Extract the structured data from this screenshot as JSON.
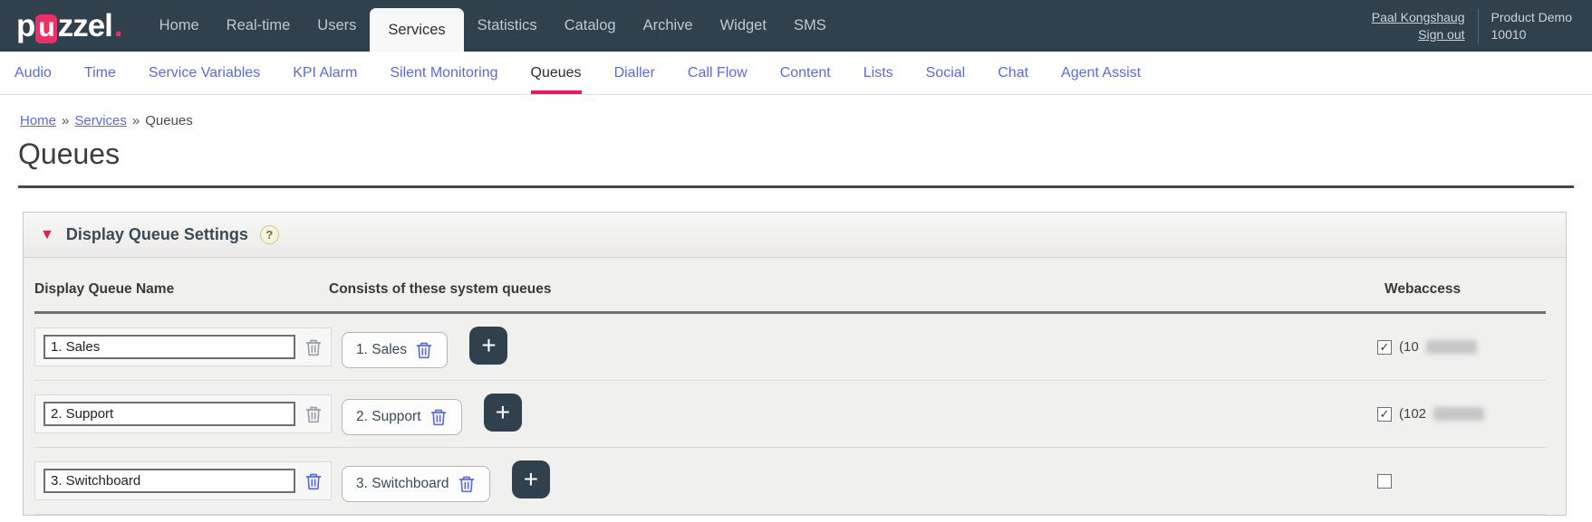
{
  "colors": {
    "brand_pink": "#e8195c",
    "navy": "#31404d",
    "link_blue": "#5b6bd5"
  },
  "topbar": {
    "logo": {
      "pre": "p",
      "u": "u",
      "post": "zzel",
      "dot": "."
    },
    "items": [
      {
        "label": "Home",
        "active": false
      },
      {
        "label": "Real-time",
        "active": false
      },
      {
        "label": "Users",
        "active": false
      },
      {
        "label": "Services",
        "active": true
      },
      {
        "label": "Statistics",
        "active": false
      },
      {
        "label": "Catalog",
        "active": false
      },
      {
        "label": "Archive",
        "active": false
      },
      {
        "label": "Widget",
        "active": false
      },
      {
        "label": "SMS",
        "active": false
      }
    ],
    "user_link": "Paal Kongshaug",
    "signout_link": "Sign out",
    "account_name": "Product Demo",
    "account_id": "10010"
  },
  "subnav": {
    "items": [
      {
        "label": "Audio",
        "active": false
      },
      {
        "label": "Time",
        "active": false
      },
      {
        "label": "Service Variables",
        "active": false
      },
      {
        "label": "KPI Alarm",
        "active": false
      },
      {
        "label": "Silent Monitoring",
        "active": false
      },
      {
        "label": "Queues",
        "active": true
      },
      {
        "label": "Dialler",
        "active": false
      },
      {
        "label": "Call Flow",
        "active": false
      },
      {
        "label": "Content",
        "active": false
      },
      {
        "label": "Lists",
        "active": false
      },
      {
        "label": "Social",
        "active": false
      },
      {
        "label": "Chat",
        "active": false
      },
      {
        "label": "Agent Assist",
        "active": false
      }
    ]
  },
  "breadcrumb": {
    "home": "Home",
    "services": "Services",
    "current": "Queues",
    "separator": "»"
  },
  "page": {
    "title": "Queues"
  },
  "panel": {
    "collapse_glyph": "▼",
    "title": "Display Queue Settings",
    "help_glyph": "?",
    "columns": {
      "name": "Display Queue Name",
      "queues": "Consists of these system queues",
      "webaccess": "Webaccess"
    },
    "add_label": "+",
    "rows": [
      {
        "name": "1. Sales",
        "chip": "1. Sales",
        "web_mark": "✓",
        "web_text": "(10",
        "redacted": true
      },
      {
        "name": "2. Support",
        "chip": "2. Support",
        "web_mark": "✓",
        "web_text": "(102",
        "redacted": true
      },
      {
        "name": "3. Switchboard",
        "chip": "3. Switchboard",
        "web_mark": "",
        "web_text": "",
        "redacted": false
      }
    ]
  }
}
